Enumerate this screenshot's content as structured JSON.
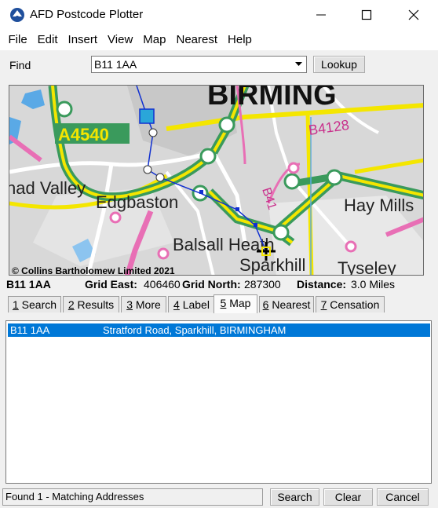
{
  "window": {
    "title": "AFD Postcode Plotter",
    "minimize_icon": "minimize-icon",
    "maximize_icon": "maximize-icon",
    "close_icon": "close-icon"
  },
  "menu": [
    "File",
    "Edit",
    "Insert",
    "View",
    "Map",
    "Nearest",
    "Help"
  ],
  "find": {
    "label": "Find",
    "value": "B11 1AA",
    "lookup_label": "Lookup"
  },
  "map": {
    "road_label": "A4540",
    "road_label_2": "B4128",
    "road_label_3": "B41",
    "city_label": "BIRMING",
    "places": [
      "Edgbaston",
      "had Valley",
      "Balsall Heath",
      "Sparkhill",
      "Hay Mills",
      "Tyseley"
    ],
    "copyright": "© Collins Bartholomew Limited 2021",
    "colors": {
      "road_green": "#3a9a5c",
      "road_yellow": "#f4e600",
      "road_pink": "#e86fb5",
      "route_blue": "#1030d0",
      "water": "#5aa9e6"
    }
  },
  "info": {
    "postcode": "B11 1AA",
    "grid_east_label": "Grid East:",
    "grid_east_value": "406460",
    "grid_north_label": "Grid North:",
    "grid_north_value": "287300",
    "distance_label": "Distance:",
    "distance_value": "3.0 Miles"
  },
  "tabs": [
    {
      "num": "1",
      "label": " Search"
    },
    {
      "num": "2",
      "label": " Results"
    },
    {
      "num": "3",
      "label": " More"
    },
    {
      "num": "4",
      "label": " Label"
    },
    {
      "num": "5",
      "label": " Map"
    },
    {
      "num": "6",
      "label": " Nearest"
    },
    {
      "num": "7",
      "label": " Censation"
    }
  ],
  "results": [
    {
      "postcode": "B11 1AA",
      "address": "Stratford Road, Sparkhill, BIRMINGHAM"
    }
  ],
  "status": {
    "text": "Found 1 - Matching Addresses",
    "search_label": "Search",
    "clear_label": "Clear",
    "cancel_label": "Cancel"
  }
}
